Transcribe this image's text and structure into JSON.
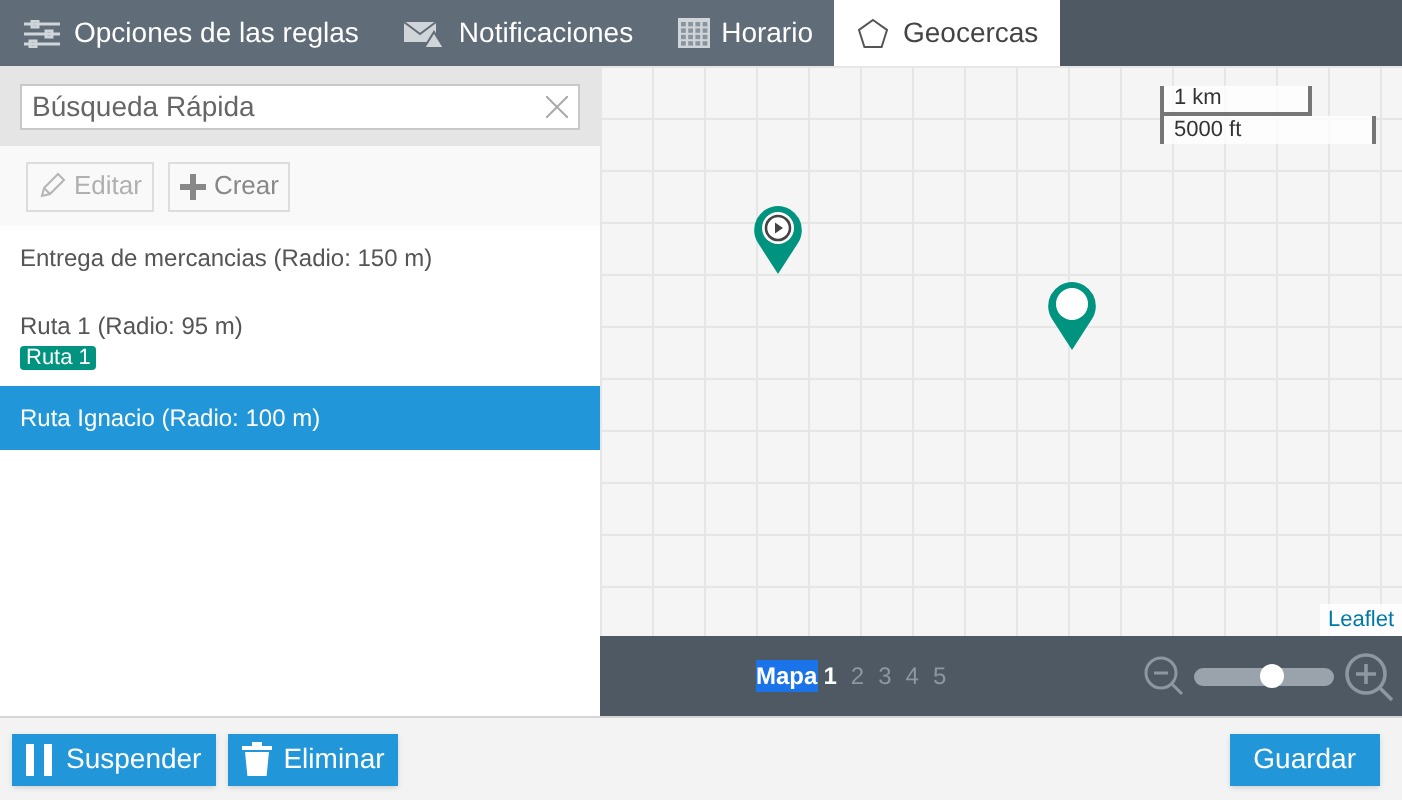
{
  "tabs": [
    {
      "label": "Opciones de las reglas",
      "kind": "sliders",
      "selected": false
    },
    {
      "label": "Notificaciones",
      "kind": "mail",
      "selected": false
    },
    {
      "label": "Horario",
      "kind": "calendar",
      "selected": false
    },
    {
      "label": "Geocercas",
      "kind": "pentagon",
      "selected": true
    }
  ],
  "search": {
    "placeholder": "Búsqueda Rápida"
  },
  "toolbar": [
    {
      "label": "Editar",
      "kind": "pencil",
      "disabled": true
    },
    {
      "label": "Crear",
      "kind": "plus",
      "disabled": false
    }
  ],
  "geofences": [
    {
      "name": "Entrega de mercancias (Radio: 150 m)",
      "selected": false
    },
    {
      "name": "Ruta 1 (Radio: 95 m)",
      "tag": "Ruta 1",
      "selected": false
    },
    {
      "name": "Ruta Ignacio (Radio: 100 m)",
      "selected": true
    }
  ],
  "map": {
    "scale": [
      "1 km",
      "5000 ft"
    ],
    "markers": [
      {
        "kind": "play"
      },
      {
        "kind": "plain"
      }
    ],
    "attribution": "Leaflet"
  },
  "map_bar": {
    "label": "Mapa",
    "pages": [
      {
        "label": "1",
        "selected": true
      },
      {
        "label": "2",
        "selected": false
      },
      {
        "label": "3",
        "selected": false
      },
      {
        "label": "4",
        "selected": false
      },
      {
        "label": "5",
        "selected": false
      }
    ],
    "zoom": {
      "level": 0.56
    }
  },
  "footer": {
    "left": [
      {
        "label": "Suspender",
        "kind": "pause"
      },
      {
        "label": "Eliminar",
        "kind": "trash"
      }
    ],
    "right": [
      {
        "label": "Guardar"
      }
    ]
  }
}
